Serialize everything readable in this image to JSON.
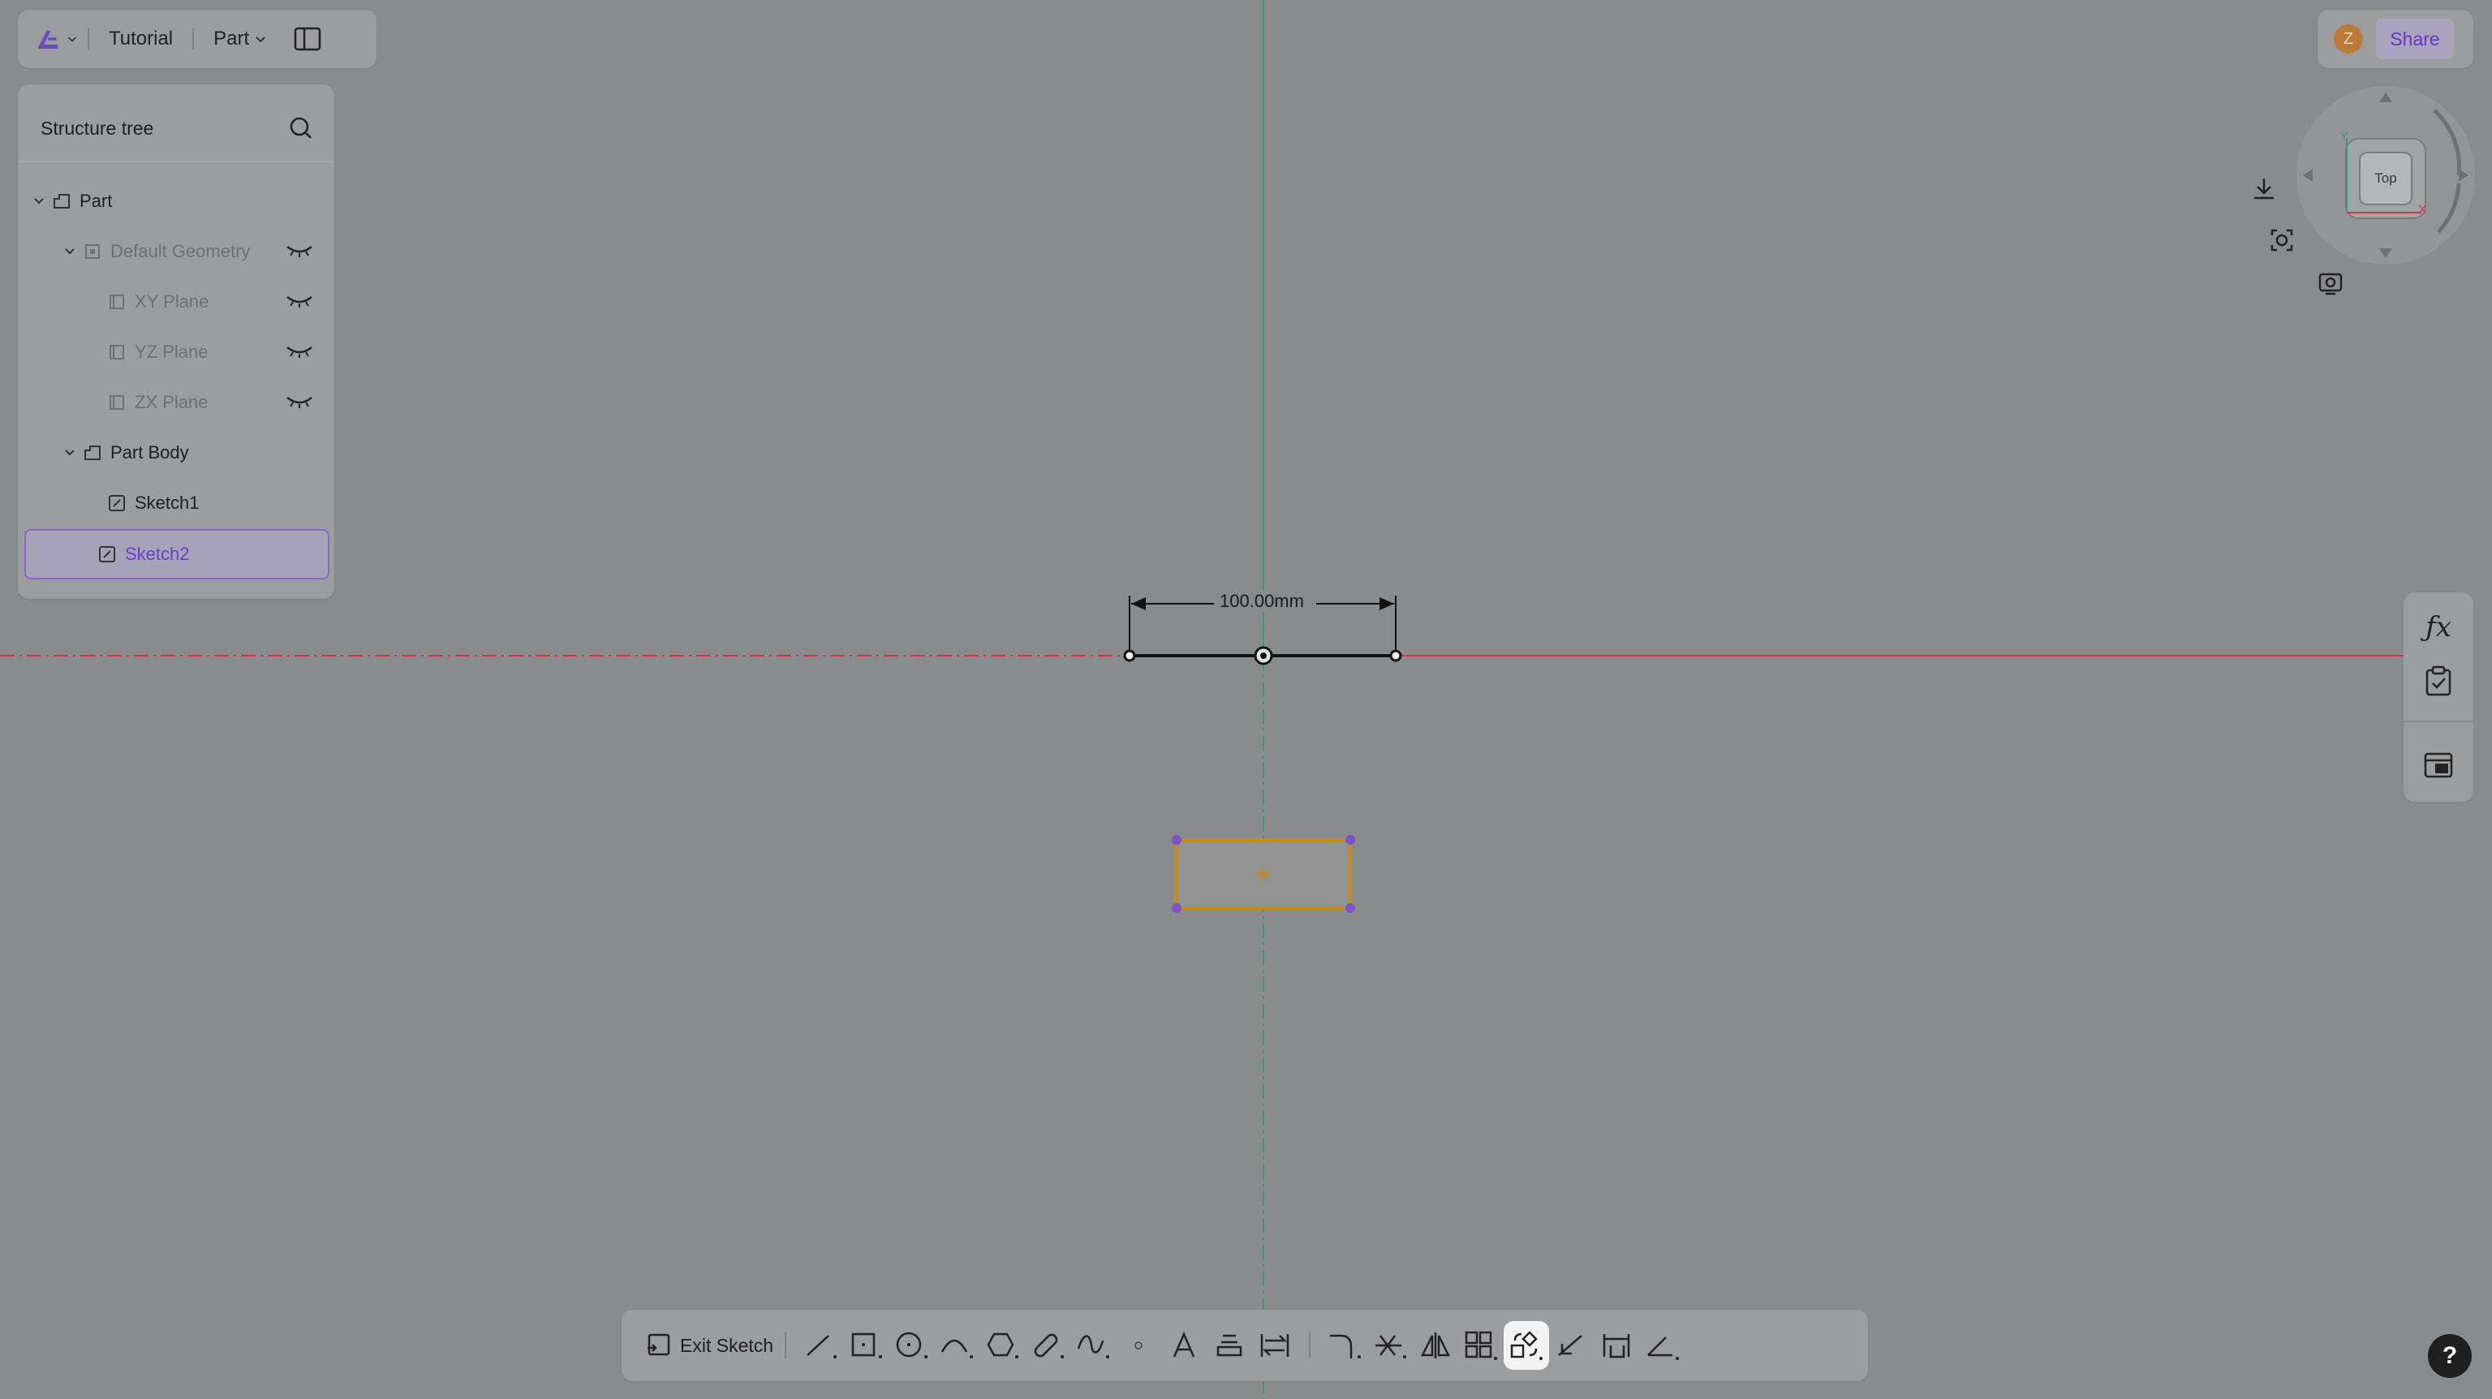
{
  "topbar": {
    "project_name": "Tutorial",
    "mode_label": "Part"
  },
  "structure_tree": {
    "title": "Structure tree",
    "items": [
      {
        "label": "Part"
      },
      {
        "label": "Default Geometry"
      },
      {
        "label": "XY Plane"
      },
      {
        "label": "YZ Plane"
      },
      {
        "label": "ZX Plane"
      },
      {
        "label": "Part Body"
      },
      {
        "label": "Sketch1"
      },
      {
        "label": "Sketch2"
      }
    ]
  },
  "user": {
    "avatar_initial": "Z",
    "share_label": "Share"
  },
  "view_cube": {
    "face_label": "Top",
    "axis_y": "Y",
    "axis_x": "X"
  },
  "sketch": {
    "dimension_label": "100.00mm"
  },
  "toolbar": {
    "exit_sketch_label": "Exit Sketch",
    "tools": [
      "line-tool",
      "rectangle-tool",
      "circle-tool",
      "arc-tool",
      "polygon-tool",
      "slot-tool",
      "spline-tool",
      "point-tool",
      "text-tool",
      "offset-tool",
      "project-tool",
      "fillet-tool",
      "trim-tool",
      "mirror-tool",
      "pattern-tool",
      "transform-tool",
      "extend-tool",
      "dimension-tool",
      "constraint-tool"
    ],
    "active_tool": "transform-tool"
  },
  "help_label": "?",
  "colors": {
    "background": "#8a8b8d",
    "panel": "#9c9d9f",
    "accent_purple": "#6a3fc9",
    "axis_red": "#c8374e",
    "axis_green": "#3e9a6e",
    "sketch_orange": "#c98a16"
  }
}
